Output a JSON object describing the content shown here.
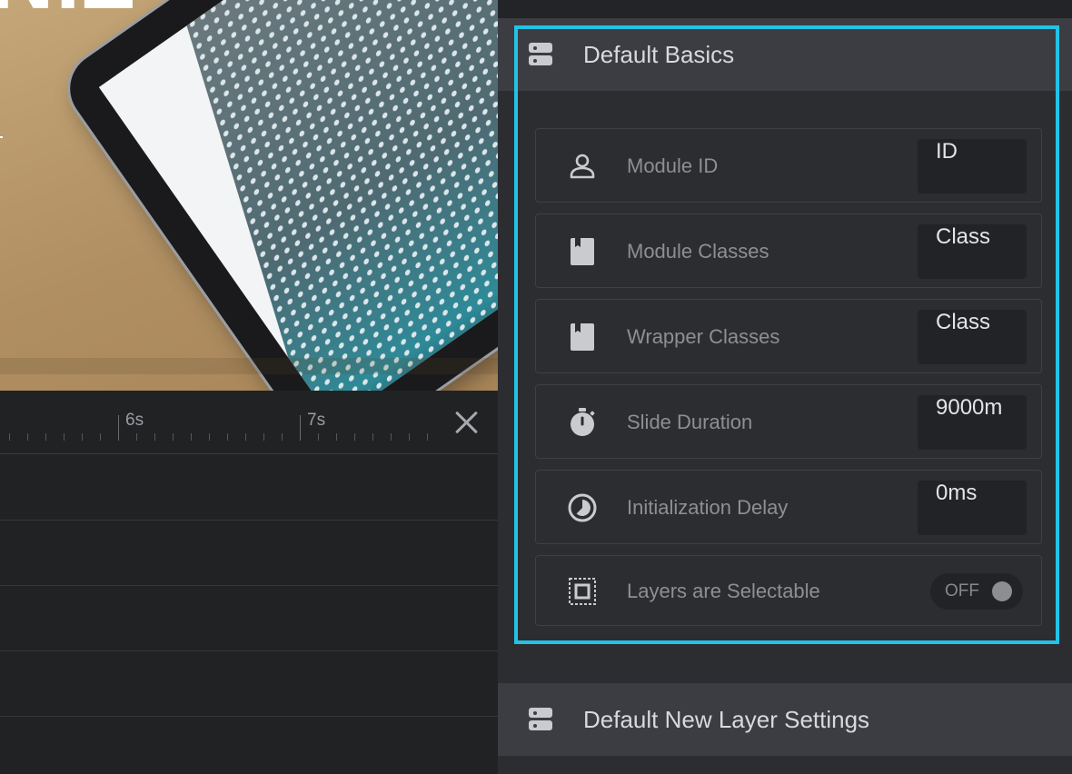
{
  "preview": {
    "overlay_text": "NIZ"
  },
  "timeline": {
    "ruler_labels": [
      "6s",
      "7s"
    ],
    "close_icon": "close-icon"
  },
  "panel": {
    "section_basics": {
      "title": "Default Basics",
      "icon": "server-icon"
    },
    "rows": [
      {
        "label": "Module ID",
        "value": "ID",
        "icon": "user-icon"
      },
      {
        "label": "Module Classes",
        "value": "Class",
        "icon": "bookmark-icon"
      },
      {
        "label": "Wrapper Classes",
        "value": "Class",
        "icon": "bookmark-icon"
      },
      {
        "label": "Slide Duration",
        "value": "9000m",
        "icon": "stopwatch-icon"
      },
      {
        "label": "Initialization Delay",
        "value": "0ms",
        "icon": "clock-icon"
      }
    ],
    "layers_selectable": {
      "label": "Layers are Selectable",
      "toggle_label": "OFF",
      "icon": "select-frame-icon"
    },
    "section_new_layer": {
      "title": "Default New Layer Settings",
      "icon": "server-icon"
    },
    "highlight_color": "#23c2e6"
  }
}
